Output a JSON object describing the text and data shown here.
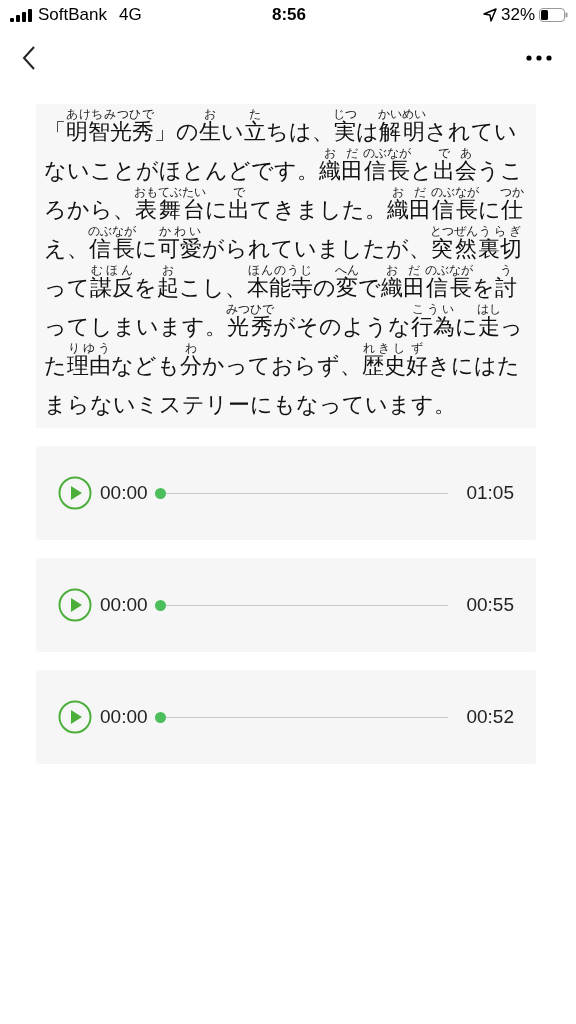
{
  "status_bar": {
    "carrier": "SoftBank",
    "network": "4G",
    "time": "8:56",
    "battery": "32%"
  },
  "article": {
    "segments": [
      {
        "text": "「"
      },
      {
        "text": "明智光秀",
        "ruby": "あけちみつひで"
      },
      {
        "text": "」の"
      },
      {
        "text": "生",
        "ruby": "お"
      },
      {
        "text": "い"
      },
      {
        "text": "立",
        "ruby": "た"
      },
      {
        "text": "ちは、"
      },
      {
        "text": "実",
        "ruby": "じつ"
      },
      {
        "text": "は"
      },
      {
        "text": "解明",
        "ruby": "かいめい"
      },
      {
        "text": "されていないことがほとんどです。"
      },
      {
        "text": "織田",
        "ruby": "おだ"
      },
      {
        "text": "信長",
        "ruby": "のぶなが"
      },
      {
        "text": "と"
      },
      {
        "text": "出会",
        "ruby": "であ"
      },
      {
        "text": "うころから、"
      },
      {
        "text": "表舞台",
        "ruby": "おもてぶたい"
      },
      {
        "text": "に"
      },
      {
        "text": "出",
        "ruby": "で"
      },
      {
        "text": "てきました。"
      },
      {
        "text": "織田",
        "ruby": "おだ"
      },
      {
        "text": "信長",
        "ruby": "のぶなが"
      },
      {
        "text": "に"
      },
      {
        "text": "仕",
        "ruby": "つか"
      },
      {
        "text": "え、"
      },
      {
        "text": "信長",
        "ruby": "のぶなが"
      },
      {
        "text": "に"
      },
      {
        "text": "可愛",
        "ruby": "かわい"
      },
      {
        "text": "がられていましたが、"
      },
      {
        "text": "突然",
        "ruby": "とつぜん"
      },
      {
        "text": "裏切",
        "ruby": "うらぎ"
      },
      {
        "text": "って"
      },
      {
        "text": "謀反",
        "ruby": "むほん"
      },
      {
        "text": "を"
      },
      {
        "text": "起",
        "ruby": "お"
      },
      {
        "text": "こし、"
      },
      {
        "text": "本能寺",
        "ruby": "ほんのうじ"
      },
      {
        "text": "の"
      },
      {
        "text": "変",
        "ruby": "へん"
      },
      {
        "text": "で"
      },
      {
        "text": "織田",
        "ruby": "おだ"
      },
      {
        "text": "信長",
        "ruby": "のぶなが"
      },
      {
        "text": "を"
      },
      {
        "text": "討",
        "ruby": "う"
      },
      {
        "text": "ってしまいます。"
      },
      {
        "text": "光秀",
        "ruby": "みつひで"
      },
      {
        "text": "がそのような"
      },
      {
        "text": "行為",
        "ruby": "こうい"
      },
      {
        "text": "に"
      },
      {
        "text": "走",
        "ruby": "はし"
      },
      {
        "text": "った"
      },
      {
        "text": "理由",
        "ruby": "りゆう"
      },
      {
        "text": "なども"
      },
      {
        "text": "分",
        "ruby": "わ"
      },
      {
        "text": "かっておらず、"
      },
      {
        "text": "歴史",
        "ruby": "れきし"
      },
      {
        "text": "好",
        "ruby": "ず"
      },
      {
        "text": "きにはたまらないミステリーにもなっています。"
      }
    ]
  },
  "players": [
    {
      "current": "00:00",
      "duration": "01:05",
      "level": 0
    },
    {
      "current": "00:00",
      "duration": "00:55",
      "level": 0
    },
    {
      "current": "00:00",
      "duration": "00:52",
      "level": 0
    }
  ]
}
